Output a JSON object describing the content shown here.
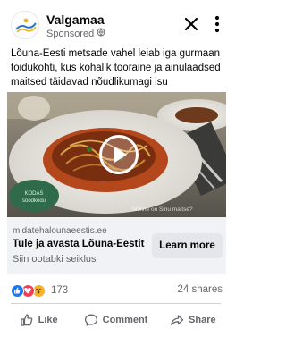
{
  "post": {
    "page_name": "Valgamaa",
    "sponsored_label": "Sponsored",
    "text": "Lõuna-Eesti metsade vahel leiab iga gurmaan toidukohti, kus kohalik tooraine ja ainulaadsed maitsed täidavad nõudlikumagi isu"
  },
  "media": {
    "badge_text": "KODAS\nsöödkodu",
    "watermark": "Möline on Sinu maitse?"
  },
  "link": {
    "domain": "midatehalounaeestis.ee",
    "title": "Tule ja avasta Lõuna-Eestit",
    "description": "Siin ootabki seiklus",
    "cta_label": "Learn more"
  },
  "engagement": {
    "reaction_count": "173",
    "shares": "24 shares"
  },
  "actions": {
    "like": "Like",
    "comment": "Comment",
    "share": "Share"
  },
  "icons": {
    "close": "close-icon",
    "more": "more-vertical-icon",
    "play": "play-icon",
    "globe": "globe-icon"
  },
  "colors": {
    "brand_blue": "#1877f2",
    "love_red": "#f33e58",
    "wow_yellow": "#f7b125"
  }
}
